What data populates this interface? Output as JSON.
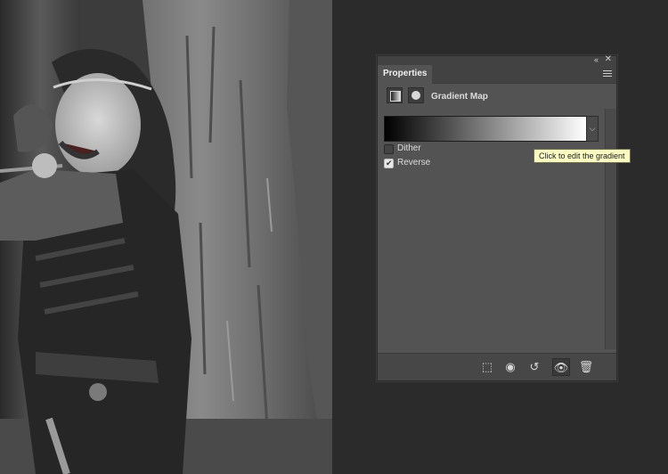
{
  "panel": {
    "tab_label": "Properties",
    "collapse_glyph": "«",
    "close_glyph": "✕",
    "adjustment_title": "Gradient Map",
    "gradient": {
      "start_color": "#000000",
      "end_color": "#ffffff",
      "dropdown_glyph": "⌵"
    },
    "options": [
      {
        "label": "Dither",
        "checked": false
      },
      {
        "label": "Reverse",
        "checked": true
      }
    ],
    "footer_icons": [
      {
        "name": "clip-to-layer-icon",
        "glyph": "⬚"
      },
      {
        "name": "view-previous-state-icon",
        "glyph": "◉"
      },
      {
        "name": "reset-icon",
        "glyph": "↺"
      },
      {
        "name": "visibility-eye-icon",
        "glyph": "👁"
      },
      {
        "name": "trash-icon",
        "glyph": "🗑"
      }
    ]
  },
  "tooltip": {
    "text": "Click to edit the gradient"
  },
  "colors": {
    "workspace_bg": "#2b2b2b",
    "panel_bg": "#535353",
    "tooltip_bg": "#fbfcc2"
  }
}
